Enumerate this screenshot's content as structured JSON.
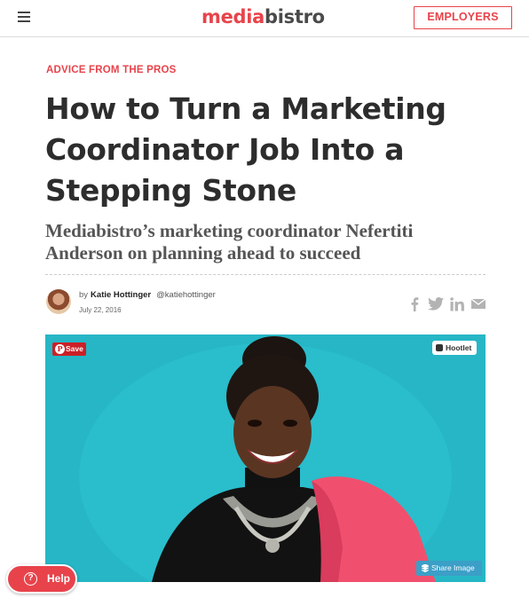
{
  "header": {
    "logo_part1": "media",
    "logo_part2": "bistro",
    "employers_label": "EMPLOYERS",
    "menu_icon": "hamburger-menu-icon"
  },
  "article": {
    "kicker": "ADVICE FROM THE PROS",
    "title": "How to Turn a Marketing Coordinator Job Into a Stepping Stone",
    "subtitle": "Mediabistro’s marketing coordinator Nefertiti Anderson on planning ahead to succeed",
    "byline_prefix": "by",
    "author": "Katie Hottinger",
    "handle": "@katiehottinger",
    "date": "July 22, 2016"
  },
  "share": {
    "icons": [
      "facebook-icon",
      "twitter-icon",
      "linkedin-icon",
      "email-icon"
    ]
  },
  "hero": {
    "save_label": "Save",
    "hootlet_label": "Hootlet",
    "share_image_label": "Share Image",
    "background_color": "#26b6c6"
  },
  "help": {
    "label": "Help"
  },
  "colors": {
    "accent": "#e8434b",
    "pinterest": "#cb2027"
  }
}
